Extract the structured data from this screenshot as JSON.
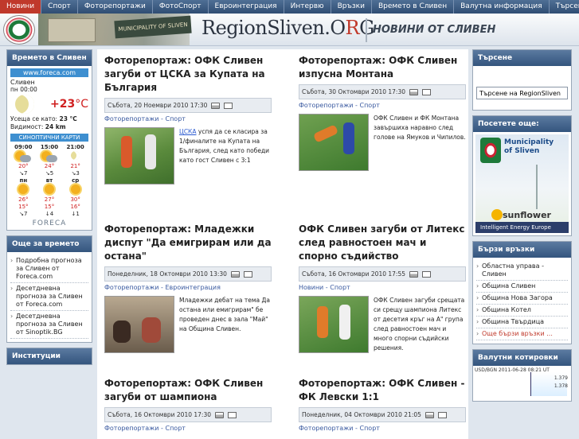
{
  "nav": [
    "Новини",
    "Спорт",
    "Фоторепортажи",
    "ФотоСпорт",
    "Евроинтеграция",
    "Интервю",
    "Връзки",
    "Времето в Сливен",
    "Валутна информация",
    "Търсене"
  ],
  "header": {
    "logo_main": "RegionSliven.O",
    "logo_r": "R",
    "logo_end": "G",
    "tagline": "НОВИНИ ОТ СЛИВЕН",
    "sign": "MUNICIPALITY OF SLIVEN"
  },
  "weather": {
    "title": "Времето в Сливен",
    "source": "www.foreca.com",
    "city": "Сливен",
    "time": "пн 00:00",
    "temp": "+23",
    "unit": "°C",
    "feels_label": "Усеща се като:",
    "feels": "23 °C",
    "vis_label": "Видимост:",
    "vis": "24 km",
    "synoptic": "СИНОПТИЧНИ КАРТИ",
    "hours": [
      "09:00",
      "15:00",
      "21:00"
    ],
    "hour_temps": [
      "20°",
      "24°",
      "21°"
    ],
    "hour_wind": [
      "↘7",
      "↘5",
      "↘3"
    ],
    "days": [
      "пн",
      "вт",
      "ср"
    ],
    "day_hi": [
      "26°",
      "27°",
      "30°"
    ],
    "day_lo": [
      "15°",
      "15°",
      "16°"
    ],
    "day_wind": [
      "↘7",
      "↓4",
      "↓1"
    ],
    "brand": "FORECA"
  },
  "more_weather": {
    "title": "Още за времето ...",
    "items": [
      "Подробна прогноза за Сливен от Foreca.com",
      "Десетдневна прогноза за Сливен от Foreca.com",
      "Десетдневна прогноза за Сливен от Sinoptik.BG"
    ]
  },
  "bottom_left": "Институции",
  "articles": [
    {
      "title": "Фоторепортаж: ОФК Сливен загуби от ЦСКА за Купата на България",
      "date": "Събота, 20 Ноември 2010 17:30",
      "cat": "Фоторепортажи - Спорт",
      "lnk": "ЦСКА",
      "text": " успя да се класира за 1/финалите на Купата на България, след като победи като гост Сливен с 3:1"
    },
    {
      "title": "Фоторепортаж: ОФК Сливен изпусна Монтана",
      "date": "Събота, 30 Октомври 2010 17:30",
      "cat": "Фоторепортажи - Спорт",
      "lnk": "",
      "text": "ОФК Сливен и ФК Монтана завършиха наравно след голове на Ямуков и Чипилов."
    },
    {
      "title": "Фоторепортаж: Младежки диспут \"Да емигрирам или да остана\"",
      "date": "Понеделник, 18 Октомври 2010 13:30",
      "cat": "Фоторепортажи - Евроинтеграция",
      "lnk": "",
      "text": "Младежки дебат на тема  Да остана или емигрирам\" бе проведен днес в зала \"Май\" на Община Сливен."
    },
    {
      "title": "ОФК Сливен загуби от Литекс след равностоен мач и спорно съдийство",
      "date": "Събота, 16 Октомври 2010 17:55",
      "cat": "Новини - Спорт",
      "lnk": "",
      "text": "ОФК Сливен загуби срещата си срещу шампиона Литекс от десетия кръг на А\" група след равностоен мач и много спорни съдийски решения."
    },
    {
      "title": "Фоторепортаж: ОФК Сливен загуби от шампиона",
      "date": "Събота, 16 Октомври 2010 17:30",
      "cat": "Фоторепортажи - Спорт",
      "lnk": "",
      "text": ""
    },
    {
      "title": "Фоторепортаж: ОФК Сливен - ФК Левски 1:1",
      "date": "Понеделник, 04 Октомври 2010 21:05",
      "cat": "Фоторепортажи - Спорт",
      "lnk": "",
      "text": ""
    }
  ],
  "search": {
    "title": "Търсене",
    "placeholder": "Търсене на RegionSliven"
  },
  "visit": {
    "title": "Посетете още:",
    "banner_l1": "Municipality",
    "banner_l2": "of Sliven",
    "banner_sf": "sunflower",
    "banner_ie": "Intelligent Energy  Europe"
  },
  "quick": {
    "title": "Бързи връзки",
    "items": [
      "Областна управа - Сливен",
      "Община Сливен",
      "Община Нова Загора",
      "Община Котел",
      "Община Твърдица",
      "Още бързи връзки ..."
    ]
  },
  "fx": {
    "title": "Валутни котировки",
    "label": "USD/BGN 2011-06-28 08:21 UT",
    "v1": "1.379",
    "v2": "1.378"
  },
  "colors": {
    "accent": "#c0392b",
    "header_blue": "#34557e",
    "link": "#2a5ad0"
  }
}
